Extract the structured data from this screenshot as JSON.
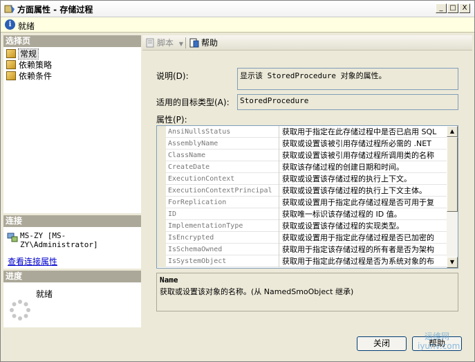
{
  "window": {
    "title": "方面属性 - 存储过程",
    "controls": {
      "minimize": "_",
      "maximize": "□",
      "close": "X"
    }
  },
  "status": {
    "icon": "info-icon",
    "text": "就绪"
  },
  "left_panel": {
    "select_page_header": "选择页",
    "pages": [
      {
        "label": "常规",
        "icon": "page-icon",
        "selected": true
      },
      {
        "label": "依赖策略",
        "icon": "page-icon",
        "selected": false
      },
      {
        "label": "依赖条件",
        "icon": "page-icon",
        "selected": false
      }
    ],
    "connection_header": "连接",
    "connection_text": "MS-ZY [MS-ZY\\Administrator]",
    "view_connection_link": "查看连接属性",
    "progress_header": "进度",
    "progress_text": "就绪"
  },
  "toolbar": {
    "script_label": "脚本",
    "help_label": "帮助"
  },
  "form": {
    "description_label": "说明(D):",
    "description_value": "显示该 StoredProcedure 对象的属性。",
    "target_type_label": "适用的目标类型(A):",
    "target_type_value": "StoredProcedure",
    "properties_label": "属性(P):"
  },
  "properties": [
    {
      "name": "AnsiNullsStatus",
      "desc": "获取用于指定在此存储过程中是否已启用 SQL"
    },
    {
      "name": "AssemblyName",
      "desc": "获取或设置该被引用存储过程所必需的 .NET"
    },
    {
      "name": "ClassName",
      "desc": "获取或设置该被引用存储过程所调用类的名称"
    },
    {
      "name": "CreateDate",
      "desc": "获取该存储过程的创建日期和时间。"
    },
    {
      "name": "ExecutionContext",
      "desc": "获取或设置该存储过程的执行上下文。"
    },
    {
      "name": "ExecutionContextPrincipal",
      "desc": "获取或设置该存储过程的执行上下文主体。"
    },
    {
      "name": "ForReplication",
      "desc": "获取或设置用于指定此存储过程是否可用于复"
    },
    {
      "name": "ID",
      "desc": "获取唯一标识该存储过程的 ID 值。"
    },
    {
      "name": "ImplementationType",
      "desc": "获取或设置该存储过程的实现类型。"
    },
    {
      "name": "IsEncrypted",
      "desc": "获取或设置用于指定此存储过程是否已加密的"
    },
    {
      "name": "IsSchemaOwned",
      "desc": "获取用于指定该存储过程的所有者是否为架构"
    },
    {
      "name": "IsSystemObject",
      "desc": "获取用于指定此存储过程是否为系统对象的布"
    }
  ],
  "description_panel": {
    "title": "Name",
    "text": "获取或设置该对象的名称。(从 NamedSmoObject 继承)"
  },
  "buttons": {
    "close": "关闭",
    "help": "帮助"
  },
  "watermark": {
    "line1": "运维网",
    "line2": "iyunv.com"
  }
}
